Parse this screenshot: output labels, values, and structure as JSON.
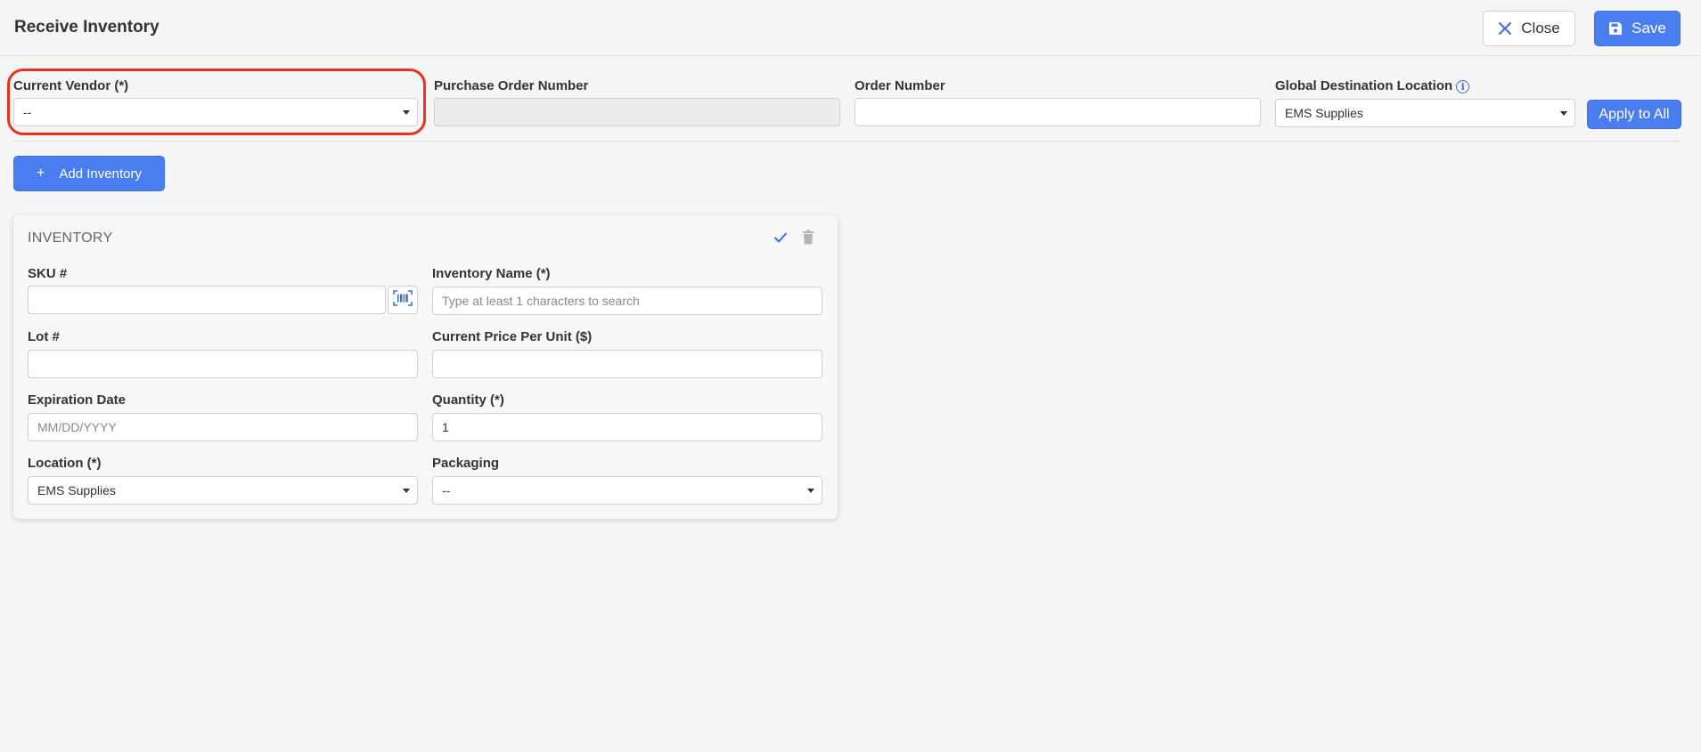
{
  "header": {
    "title": "Receive Inventory",
    "close_label": "Close",
    "save_label": "Save"
  },
  "top_form": {
    "vendor": {
      "label": "Current Vendor (*)",
      "value": "--"
    },
    "purchase_order": {
      "label": "Purchase Order Number",
      "value": ""
    },
    "order_number": {
      "label": "Order Number",
      "value": ""
    },
    "global_destination": {
      "label": "Global Destination Location",
      "value": "EMS Supplies"
    },
    "apply_label": "Apply to All"
  },
  "add_inventory_label": "Add Inventory",
  "inventory_card": {
    "title": "INVENTORY",
    "sku": {
      "label": "SKU #",
      "value": ""
    },
    "inventory_name": {
      "label": "Inventory Name (*)",
      "placeholder": "Type at least 1 characters to search"
    },
    "lot": {
      "label": "Lot #",
      "value": ""
    },
    "price": {
      "label": "Current Price Per Unit ($)",
      "value": ""
    },
    "expiration": {
      "label": "Expiration Date",
      "placeholder": "MM/DD/YYYY"
    },
    "quantity": {
      "label": "Quantity (*)",
      "value": "1"
    },
    "location": {
      "label": "Location (*)",
      "value": "EMS Supplies"
    },
    "packaging": {
      "label": "Packaging",
      "value": "--"
    }
  },
  "colors": {
    "accent": "#4a7df0",
    "highlight": "#e8321e",
    "background": "#f5f5f5"
  },
  "icons": [
    "close-icon",
    "save-icon",
    "info-icon",
    "plus-icon",
    "check-icon",
    "trash-icon",
    "barcode-scan-icon",
    "caret-down-icon"
  ]
}
